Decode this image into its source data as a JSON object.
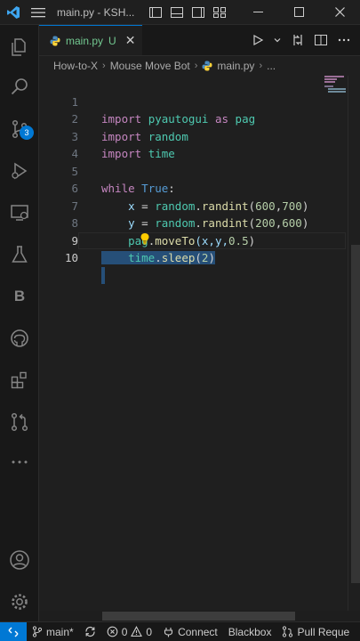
{
  "window": {
    "title": "main.py - KSH..."
  },
  "tab": {
    "filename": "main.py",
    "modified": "U"
  },
  "breadcrumb": {
    "items": [
      "How-to-X",
      "Mouse Move Bot",
      "main.py",
      "..."
    ]
  },
  "editor": {
    "lines": [
      {
        "num": "1"
      },
      {
        "num": "2"
      },
      {
        "num": "3"
      },
      {
        "num": "4"
      },
      {
        "num": "5"
      },
      {
        "num": "6"
      },
      {
        "num": "7"
      },
      {
        "num": "8"
      },
      {
        "num": "9"
      },
      {
        "num": "10"
      }
    ],
    "tokens": {
      "l1_import": "import",
      "l1_mod": "pyautogui",
      "l1_as": "as",
      "l1_alias": "pag",
      "l2_import": "import",
      "l2_mod": "random",
      "l3_import": "import",
      "l3_mod": "time",
      "l5_while": "while",
      "l5_true": "True",
      "l5_colon": ":",
      "l6_var": "x",
      "l6_eq": " = ",
      "l6_mod": "random",
      "l6_dot": ".",
      "l6_fn": "randint",
      "l6_open": "(",
      "l6_a": "600",
      "l6_comma": ",",
      "l6_b": "700",
      "l6_close": ")",
      "l7_var": "y",
      "l7_eq": " = ",
      "l7_mod": "random",
      "l7_dot": ".",
      "l7_fn": "randint",
      "l7_open": "(",
      "l7_a": "200",
      "l7_comma": ",",
      "l7_b": "600",
      "l7_close": ")",
      "l8_mod": "pag",
      "l8_dot": ".",
      "l8_fn": "moveTo",
      "l8_args": "(x,y,",
      "l8_num": "0.5",
      "l8_close": ")",
      "l9_mod": "time",
      "l9_dot": ".",
      "l9_fn": "sleep",
      "l9_open": "(",
      "l9_num": "2",
      "l9_close": ")"
    }
  },
  "activitybar": {
    "scm_badge": "3",
    "blackbox_letter": "B"
  },
  "statusbar": {
    "branch": "main*",
    "errors": "0",
    "warnings": "0",
    "connect": "Connect",
    "blackbox": "Blackbox",
    "pull_requests": "Pull Reque"
  },
  "colors": {
    "accent": "#0078d4",
    "keyword": "#c586c0",
    "module": "#4ec9b0",
    "function": "#dcdcaa",
    "number": "#b5cea8",
    "variable": "#9cdcfe",
    "modified": "#73c991"
  }
}
